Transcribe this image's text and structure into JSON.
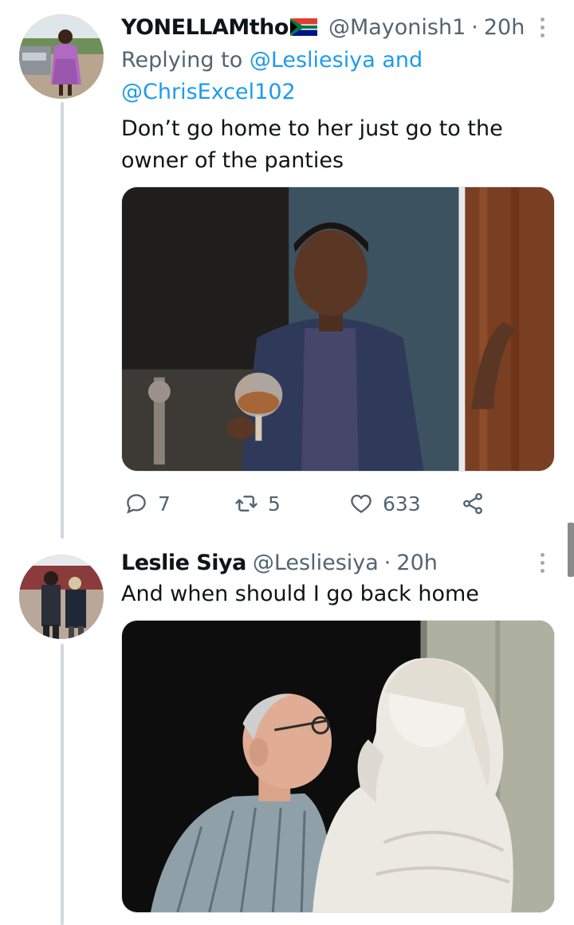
{
  "tweets": [
    {
      "author_name": "YONELLAMtho",
      "author_flag": "south-africa-flag-icon",
      "author_handle": "@Mayonish1",
      "separator": "·",
      "time": "20h",
      "reply_prefix": "Replying to ",
      "reply_mention_1": "@Lesliesiya",
      "reply_conjunction": " and",
      "reply_mention_2": "@ChrisExcel102",
      "text": "Don’t go home to her just go to the owner of the panties",
      "media_description": "photo-man-with-wine-glass",
      "stats": {
        "replies": "7",
        "retweets": "5",
        "likes": "633"
      }
    },
    {
      "author_name": "Leslie Siya",
      "author_handle": "@Lesliesiya",
      "separator": "·",
      "time": "20h",
      "text": "And when should I go back home",
      "media_description": "photo-man-with-statue"
    }
  ],
  "colors": {
    "text_primary": "#0f1419",
    "text_secondary": "#536471",
    "link": "#1d9bf0",
    "thread_line": "#cfd9de"
  }
}
